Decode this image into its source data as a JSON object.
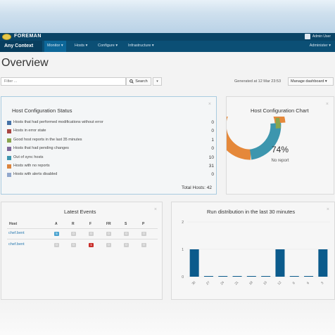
{
  "navbar": {
    "brand": "FOREMAN",
    "user": "Admin User",
    "context": "Any Context",
    "menu": [
      {
        "label": "Monitor ▾",
        "active": true
      },
      {
        "label": "Hosts ▾",
        "active": false
      },
      {
        "label": "Configure ▾",
        "active": false
      },
      {
        "label": "Infrastructure ▾",
        "active": false
      }
    ],
    "admin": "Administer ▾"
  },
  "page": {
    "title": "Overview",
    "filter_placeholder": "Filter ...",
    "search_label": "Search",
    "generated": "Generated at 12 Mar 23:53",
    "manage_label": "Manage dashboard ▾"
  },
  "host_config_status": {
    "title": "Host Configuration Status",
    "rows": [
      {
        "label": "Hosts that had performed modifications without error",
        "count": "0",
        "color": "#4572a7"
      },
      {
        "label": "Hosts in error state",
        "count": "0",
        "color": "#aa4643"
      },
      {
        "label": "Good host reports in the last 35 minutes",
        "count": "1",
        "color": "#89a54e"
      },
      {
        "label": "Hosts that had pending changes",
        "count": "0",
        "color": "#80699b"
      },
      {
        "label": "Out of sync hosts",
        "count": "10",
        "color": "#3d96ae"
      },
      {
        "label": "Hosts with no reports",
        "count": "31",
        "color": "#db843d"
      },
      {
        "label": "Hosts with alerts disabled",
        "count": "0",
        "color": "#92a8cd"
      }
    ],
    "total": "Total Hosts: 42"
  },
  "host_config_chart": {
    "title": "Host Configuration Chart",
    "center_pct": "74%",
    "center_label": "No report",
    "slices": [
      {
        "label": "No report",
        "value": 31,
        "color": "#e5883a"
      },
      {
        "label": "Out of sync",
        "value": 10,
        "color": "#3d96ae"
      },
      {
        "label": "Good",
        "value": 1,
        "color": "#89a54e"
      }
    ]
  },
  "latest_events": {
    "title": "Latest Events",
    "headers": [
      "Host",
      "A",
      "R",
      "F",
      "FR",
      "S",
      "P"
    ],
    "rows": [
      {
        "host": "chef.bent",
        "badges": [
          "5",
          "0",
          "0",
          "0",
          "0",
          "0"
        ],
        "colors": [
          "#4aa3d0",
          "#cfcfcf",
          "#cfcfcf",
          "#cfcfcf",
          "#cfcfcf",
          "#cfcfcf"
        ]
      },
      {
        "host": "chef.bent",
        "badges": [
          "0",
          "0",
          "1",
          "0",
          "0",
          "0"
        ],
        "colors": [
          "#cfcfcf",
          "#cfcfcf",
          "#c9302c",
          "#cfcfcf",
          "#cfcfcf",
          "#cfcfcf"
        ]
      }
    ]
  },
  "run_distribution": {
    "title": "Run distribution in the last 30 minutes"
  },
  "chart_data": {
    "type": "bar",
    "title": "Run distribution in the last 30 minutes",
    "categories": [
      "30",
      "27",
      "24",
      "21",
      "18",
      "15",
      "12",
      "9",
      "6",
      "3"
    ],
    "values": [
      1,
      0,
      0,
      0,
      0,
      0,
      1,
      0,
      0,
      1
    ],
    "ylim": [
      0,
      2
    ],
    "yticks": [
      "0",
      "1",
      "2"
    ],
    "color": "#0b5b8c",
    "grid": true
  }
}
